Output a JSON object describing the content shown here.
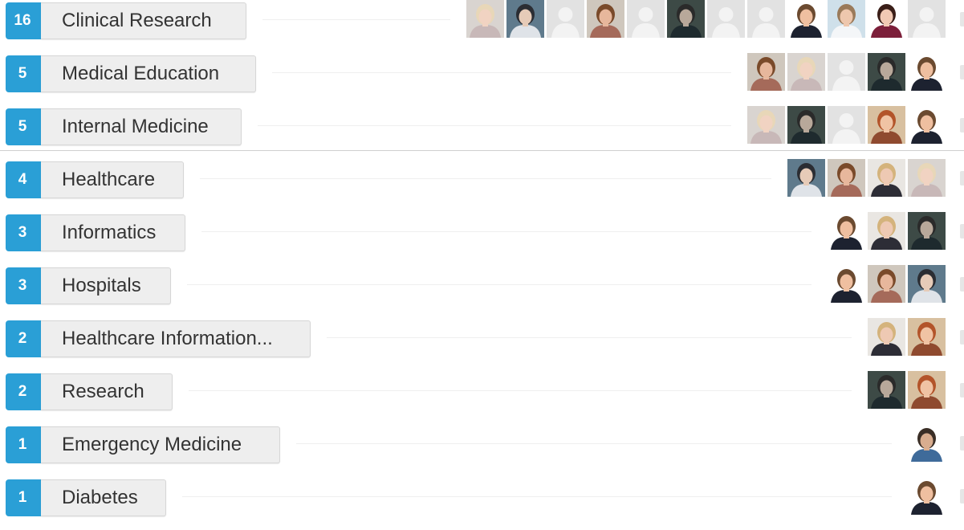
{
  "skills": [
    {
      "count": "16",
      "label": "Clinical Research",
      "avatars": [
        "photo-blonde-woman",
        "photo-woman-dark-hair",
        "default-avatar",
        "photo-woman-smiling",
        "default-avatar",
        "photo-man-dark",
        "default-avatar",
        "default-avatar",
        "photo-man-suit",
        "photo-man-doctor",
        "photo-woman-brunette",
        "default-avatar"
      ]
    },
    {
      "count": "5",
      "label": "Medical Education",
      "avatars": [
        "photo-woman-smiling",
        "photo-blonde-woman",
        "default-avatar",
        "photo-man-dark",
        "photo-man-suit"
      ]
    },
    {
      "count": "5",
      "label": "Internal Medicine",
      "avatars": [
        "photo-blonde-woman",
        "photo-man-dark",
        "default-avatar",
        "photo-woman-redhead",
        "photo-man-suit"
      ]
    },
    {
      "count": "4",
      "label": "Healthcare",
      "avatars": [
        "photo-woman-dark-hair",
        "photo-woman-smiling",
        "photo-woman-blonde-short",
        "photo-blonde-woman"
      ]
    },
    {
      "count": "3",
      "label": "Informatics",
      "avatars": [
        "photo-man-suit",
        "photo-woman-blonde-short",
        "photo-man-dark"
      ]
    },
    {
      "count": "3",
      "label": "Hospitals",
      "avatars": [
        "photo-man-suit",
        "photo-woman-smiling",
        "photo-woman-dark-hair"
      ]
    },
    {
      "count": "2",
      "label": "Healthcare Information...",
      "avatars": [
        "photo-woman-blonde-short",
        "photo-woman-redhead"
      ]
    },
    {
      "count": "2",
      "label": "Research",
      "avatars": [
        "photo-man-dark",
        "photo-woman-redhead"
      ]
    },
    {
      "count": "1",
      "label": "Emergency Medicine",
      "avatars": [
        "photo-man-tshirt"
      ]
    },
    {
      "count": "1",
      "label": "Diabetes",
      "avatars": [
        "photo-man-suit"
      ]
    }
  ],
  "colors": {
    "count_badge": "#2a9fd6",
    "skill_pill": "#eeeeee",
    "text": "#333333"
  }
}
